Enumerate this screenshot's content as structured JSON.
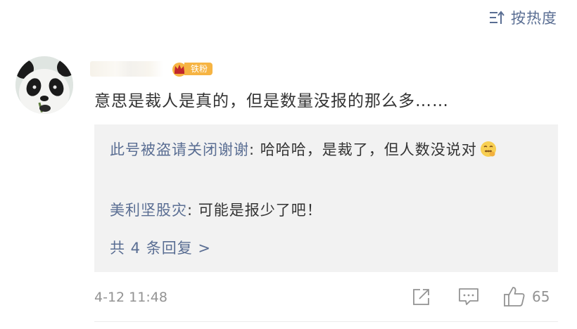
{
  "sort": {
    "label": "按热度",
    "icon": "sort-icon"
  },
  "comment": {
    "avatar_icon": "panda-avatar",
    "username": "",
    "badge": {
      "icon": "crown-icon",
      "label": "铁粉",
      "color": "#f6b443"
    },
    "text": "意思是裁人是真的，但是数量没报的那么多……",
    "replies": [
      {
        "author": "此号被盗请关闭谢谢",
        "separator": ": ",
        "text": "哈哈哈，是裁了，但人数没说对",
        "emoji": "zipper-mouth-emoji"
      },
      {
        "author": "美利坚股灾",
        "separator": ": ",
        "text": "可能是报少了吧！"
      }
    ],
    "more_replies": "共 4 条回复 >",
    "timestamp": "4-12 11:48",
    "actions": {
      "share_icon": "share-icon",
      "comment_icon": "comment-icon",
      "like_icon": "thumbs-up-icon",
      "like_count": "65"
    }
  },
  "colors": {
    "link": "#5a6e93",
    "text": "#333333",
    "muted": "#939393",
    "reply_background": "#f2f2f2"
  }
}
